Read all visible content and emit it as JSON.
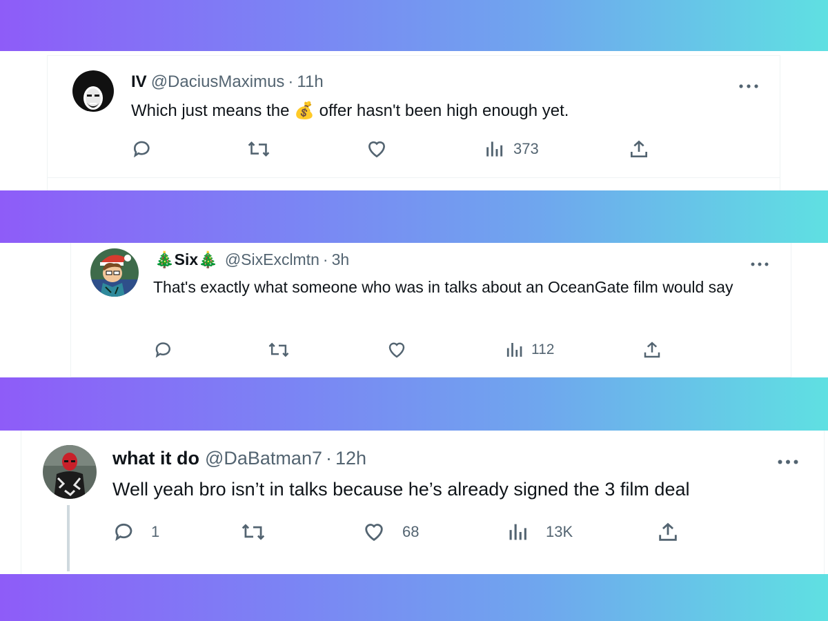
{
  "gradient_colors": [
    "#8e5cf8",
    "#7b84f4",
    "#6fa6ee",
    "#5fe0e2"
  ],
  "tweets": [
    {
      "name": "IV",
      "handle": "@DaciusMaximus",
      "separator": "·",
      "time": "11h",
      "text_before": "Which just means the",
      "emoji": "💰",
      "text_after": "offer hasn't been high enough yet.",
      "avatar_icon": "bob-ross-avatar",
      "replies": "",
      "retweets": "",
      "likes": "",
      "views": "373"
    },
    {
      "name_prefix_emoji": "🎄",
      "name": "Six",
      "name_suffix_emoji": "🎄",
      "handle": "@SixExclmtn",
      "separator": "·",
      "time": "3h",
      "text": "That's exactly what someone who was in talks about an OceanGate film would say",
      "avatar_icon": "cartoon-santa-avatar",
      "replies": "",
      "retweets": "",
      "likes": "",
      "views": "112"
    },
    {
      "name": "what it do",
      "handle": "@DaBatman7",
      "separator": "·",
      "time": "12h",
      "text": "Well yeah bro isn’t in talks because he’s already signed the 3 film deal",
      "avatar_icon": "masked-person-avatar",
      "replies": "1",
      "retweets": "",
      "likes": "68",
      "views": "13K"
    }
  ]
}
